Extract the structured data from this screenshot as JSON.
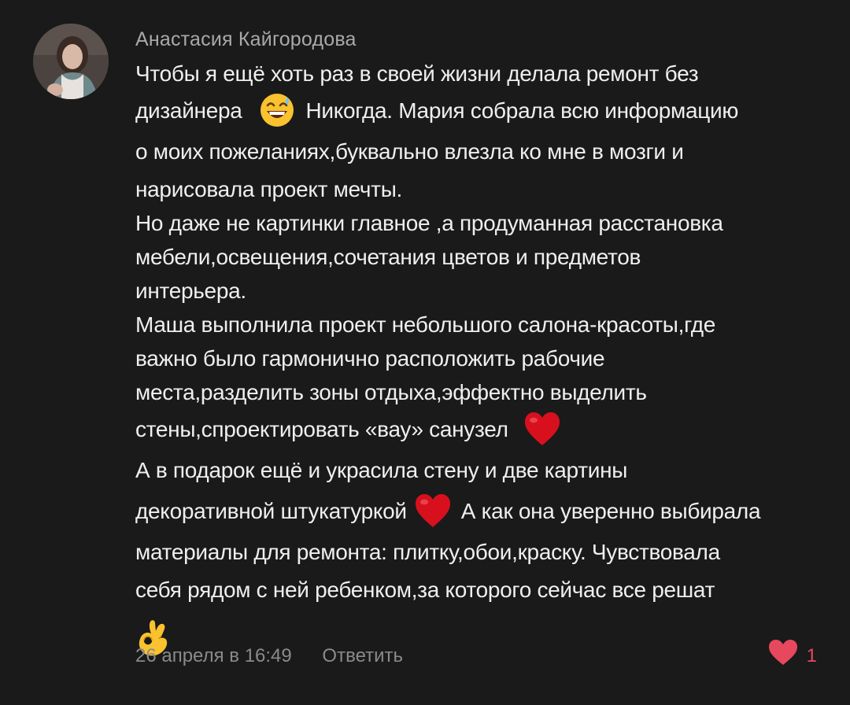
{
  "comment": {
    "author": "Анастасия Кайгородова",
    "lines": [
      "Чтобы я ещё хоть раз в своей жизни делала ремонт без",
      "дизайнера",
      "Никогда. Мария собрала всю информацию",
      "о моих пожеланиях,буквально влезла ко мне в мозги и",
      "нарисовала проект мечты.",
      "Но даже не картинки главное ,а продуманная расстановка",
      "мебели,освещения,сочетания цветов и предметов",
      "интерьера.",
      "Маша выполнила проект небольшого салона-красоты,где",
      "важно было гармонично расположить рабочие",
      "места,разделить зоны отдыха,эффектно выделить",
      "стены,спроектировать «вау» санузел",
      "А в подарок ещё и украсила стену и две картины",
      "декоративной штукатуркой",
      "А как она уверенно выбирала",
      "материалы для ремонта: плитку,обои,краску. Чувствовала",
      "себя рядом с ней ребенком,за которого сейчас все решат"
    ],
    "emojis": {
      "sweat_smile": "grinning-sweat-emoji",
      "heart": "red-heart-emoji",
      "ok_hand": "ok-hand-emoji"
    },
    "timestamp": "26 апреля в 16:49",
    "reply_label": "Ответить",
    "likes_count": "1",
    "colors": {
      "background": "#1a1a1a",
      "text": "#efefef",
      "secondary": "#8a8a8a",
      "like_red": "#e8485d"
    }
  }
}
